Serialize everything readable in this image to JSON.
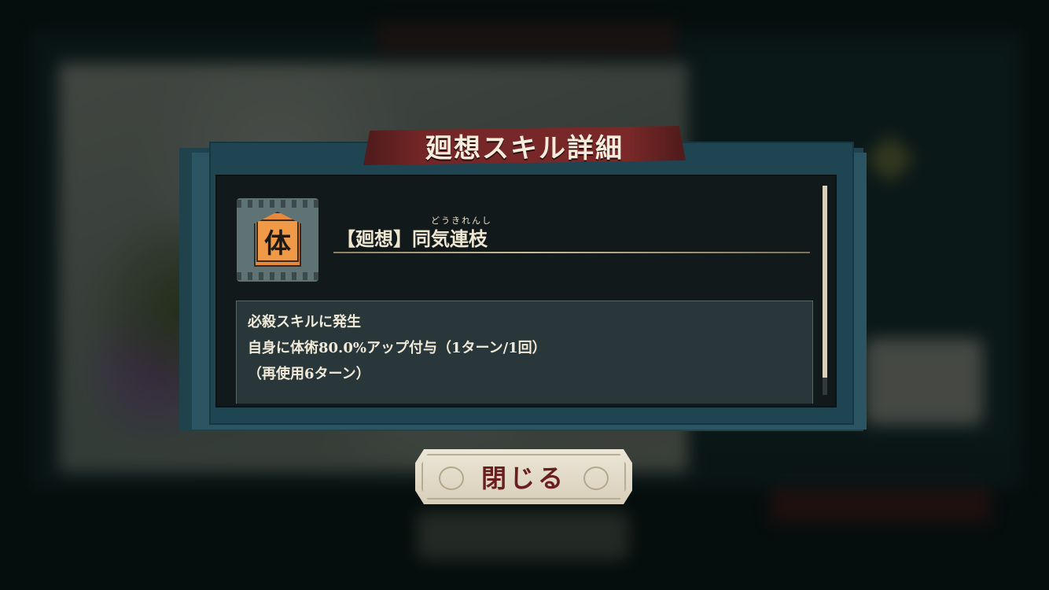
{
  "dialog": {
    "title": "廻想スキル詳細",
    "skill": {
      "icon_glyph": "体",
      "icon_color": "#e8893a",
      "ruby": "どうきれんし",
      "name": "【廻想】同気連枝"
    },
    "description": {
      "line1": "必殺スキルに発生",
      "line2": "自身に体術80.0%アップ付与（1ターン/1回）",
      "line3": "（再使用6ターン）"
    },
    "close_label": "閉じる"
  },
  "colors": {
    "banner": "#742626",
    "panel": "#1f4553",
    "close_text": "#6a1f1f"
  }
}
